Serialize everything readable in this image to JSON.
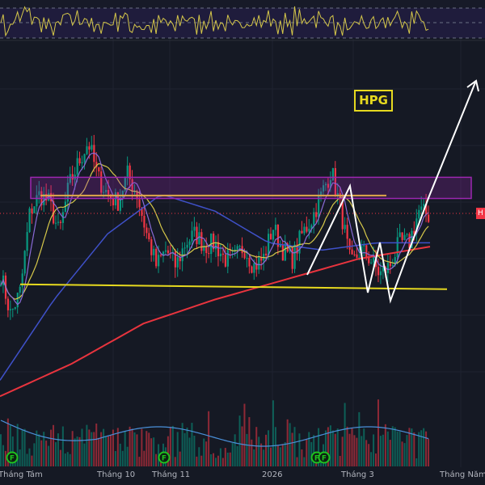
{
  "chart_data": {
    "type": "candlestick",
    "symbol": "HPG",
    "ylim": [
      0,
      100
    ],
    "price_keypoints": [
      45,
      35.5,
      41,
      60,
      64,
      62,
      54.6,
      66,
      71.6,
      76.4,
      67.8,
      64,
      62,
      68.8,
      64,
      54.6,
      47,
      50.8,
      47,
      52.5,
      54.6,
      51.7,
      52.5,
      48.7,
      48.7,
      51.7,
      47,
      48.7,
      56.3,
      50.8,
      48.7,
      54.6,
      58.3,
      64,
      69.7,
      60,
      47,
      50.8,
      48.7,
      45,
      47,
      52.5,
      52.5,
      60,
      59
    ],
    "ma_long_keypoints": [
      16.2,
      23.9,
      33.4,
      39.1,
      43.9,
      48.7,
      51.6
    ],
    "ma_mid_keypoints": [
      20,
      39,
      54.6,
      64,
      60,
      52.5,
      50.8,
      52.5,
      52.5
    ],
    "resistance_zone": [
      63,
      68
    ],
    "resistance_line": 63.7,
    "support_line": 42.5,
    "last_price_label": "H",
    "x_tick_labels": [
      "Tháng Tám",
      "Tháng 10",
      "Tháng 11",
      "2026",
      "Tháng 3",
      "Tháng Năm"
    ],
    "event_markers": [
      "F",
      "F",
      "F",
      "F"
    ],
    "colors": {
      "up": "#089981",
      "down": "#f23645",
      "ma_long": "#e8343e",
      "ma_mid": "#3f51c9",
      "ma_short": "#d6c84a",
      "zone": "#9c27b0",
      "support": "#e6d91f",
      "rsi": "#d6c84a"
    }
  },
  "annotation": {
    "ticker_label": "HPG"
  }
}
